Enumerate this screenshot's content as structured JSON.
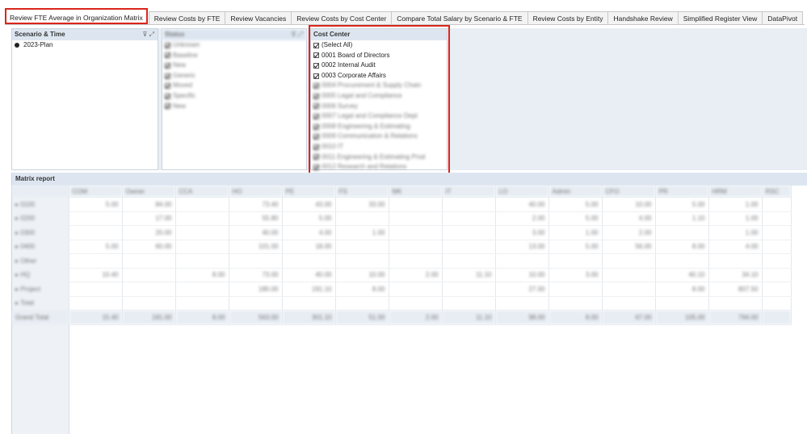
{
  "tabs": [
    {
      "label": "Review FTE Average in Organization Matrix",
      "active": true
    },
    {
      "label": "Review Costs by FTE"
    },
    {
      "label": "Review Vacancies"
    },
    {
      "label": "Review Costs by Cost Center"
    },
    {
      "label": "Compare Total Salary by Scenario & FTE"
    },
    {
      "label": "Review Costs by Entity"
    },
    {
      "label": "Handshake Review"
    },
    {
      "label": "Simplified Register View"
    },
    {
      "label": "DataPivot"
    }
  ],
  "scenario_slicer": {
    "title": "Scenario & Time",
    "icons": "filter-clear-icon, expand-icon",
    "items": [
      "2023-Plan"
    ]
  },
  "second_slicer": {
    "title": "Status",
    "items": [
      "Unknown",
      "Baseline",
      "New",
      "Generic",
      "Moved",
      "Specific",
      "New"
    ]
  },
  "cost_center_slicer": {
    "title": "Cost Center",
    "items": [
      {
        "label": "(Select All)",
        "checked": true,
        "blurred": false
      },
      {
        "label": "0001 Board of Directors",
        "checked": true,
        "blurred": false
      },
      {
        "label": "0002 Internal Audit",
        "checked": true,
        "blurred": false
      },
      {
        "label": "0003 Corporate Affairs",
        "checked": true,
        "blurred": false
      },
      {
        "label": "0004 Procurement & Supply Chain",
        "checked": true,
        "blurred": true
      },
      {
        "label": "0005 Legal and Compliance",
        "checked": true,
        "blurred": true
      },
      {
        "label": "0006 Survey",
        "checked": true,
        "blurred": true
      },
      {
        "label": "0007 Legal and Compliance Dept",
        "checked": true,
        "blurred": true
      },
      {
        "label": "0008 Engineering & Estimating",
        "checked": true,
        "blurred": true
      },
      {
        "label": "0009 Communication & Relations",
        "checked": true,
        "blurred": true
      },
      {
        "label": "0010 IT",
        "checked": true,
        "blurred": true
      },
      {
        "label": "0011 Engineering & Estimating Prod",
        "checked": true,
        "blurred": true
      },
      {
        "label": "0012 Research and Relations",
        "checked": true,
        "blurred": true
      }
    ]
  },
  "matrix": {
    "title": "Matrix report",
    "columns": [
      "",
      "COM",
      "Owner",
      "CCA",
      "HO",
      "PE",
      "FS",
      "MK",
      "IT",
      "LO",
      "Admin",
      "CFO",
      "PR",
      "HRM",
      "RSC"
    ],
    "rows": [
      {
        "label": "0100",
        "cells": [
          "5.00",
          "84.00",
          "",
          "73.40",
          "43.00",
          "33.00",
          "",
          "",
          "40.00",
          "5.00",
          "10.00",
          "5.00",
          "1.00",
          ""
        ]
      },
      {
        "label": "0200",
        "cells": [
          "",
          "17.00",
          "",
          "55.80",
          "5.00",
          "",
          "",
          "",
          "2.00",
          "5.00",
          "4.00",
          "1.10",
          "1.00",
          ""
        ]
      },
      {
        "label": "0300",
        "cells": [
          "",
          "20.00",
          "",
          "40.00",
          "4.00",
          "1.00",
          "",
          "",
          "3.00",
          "1.00",
          "2.00",
          "",
          "1.00",
          ""
        ]
      },
      {
        "label": "0400",
        "cells": [
          "5.00",
          "60.00",
          "",
          "101.00",
          "18.00",
          "",
          "",
          "",
          "13.00",
          "5.00",
          "56.00",
          "8.00",
          "4.00",
          ""
        ]
      },
      {
        "label": "Other",
        "cells": [
          "",
          "",
          "",
          "",
          "",
          "",
          "",
          "",
          "",
          "",
          "",
          "",
          "",
          ""
        ]
      },
      {
        "label": "HQ",
        "cells": [
          "10.40",
          "",
          "8.00",
          "73.00",
          "40.00",
          "10.00",
          "2.00",
          "11.10",
          "10.00",
          "3.00",
          "",
          "40.10",
          "34.10",
          ""
        ]
      },
      {
        "label": "Project",
        "cells": [
          "",
          "",
          "",
          "180.00",
          "191.10",
          "8.00",
          "",
          "",
          "27.00",
          "",
          "",
          "8.00",
          "807.50",
          ""
        ]
      },
      {
        "label": "Total",
        "cells": [
          "",
          "",
          "",
          "",
          "",
          "",
          "",
          "",
          "",
          "",
          "",
          "",
          "",
          ""
        ]
      }
    ],
    "total": {
      "label": "Grand Total",
      "cells": [
        "15.40",
        "181.00",
        "8.00",
        "563.00",
        "301.10",
        "51.00",
        "2.00",
        "11.10",
        "98.00",
        "8.00",
        "67.00",
        "105.00",
        "794.00",
        ""
      ]
    }
  },
  "colors": {
    "highlight": "#d9261c",
    "header_bg": "#dde6f0",
    "panel_bg": "#e9eef4"
  }
}
